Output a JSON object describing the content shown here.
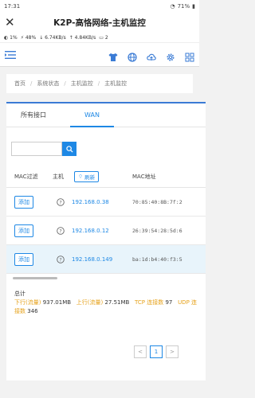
{
  "statusbar": {
    "time": "17:31",
    "battery": "71%"
  },
  "title": "K2P-高恪网络-主机监控",
  "stats": {
    "cpu": "1%",
    "mem": "48%",
    "down": "6.74KB/s",
    "up": "4.84KB/s",
    "count": "2"
  },
  "breadcrumb": [
    "首页",
    "系统状态",
    "主机监控",
    "主机监控"
  ],
  "tabs": [
    "所有接口",
    "WAN"
  ],
  "table": {
    "headers": {
      "mac_filter": "MAC过滤",
      "host": "主机",
      "refresh": "刷新",
      "mac": "MAC地址"
    },
    "rows": [
      {
        "action": "添加",
        "ip": "192.168.0.38",
        "mac": "70:85:40:8B:7f:2"
      },
      {
        "action": "添加",
        "ip": "192.168.0.12",
        "mac": "26:39:54:28:5d:6"
      },
      {
        "action": "添加",
        "ip": "192.168.0.149",
        "mac": "ba:1d:b4:40:f3:5"
      }
    ]
  },
  "summary": {
    "title": "总计",
    "down_label": "下行(流量)",
    "down_value": "937.01MB",
    "up_label": "上行(流量)",
    "up_value": "27.51MB",
    "tcp_label": "TCP 连接数",
    "tcp_value": "97",
    "udp_label": "UDP 连接数",
    "udp_value": "346"
  },
  "pager": {
    "prev": "<",
    "current": "1",
    "next": ">"
  },
  "colors": {
    "accent": "#1e88e5",
    "orange": "#e6a21b"
  }
}
